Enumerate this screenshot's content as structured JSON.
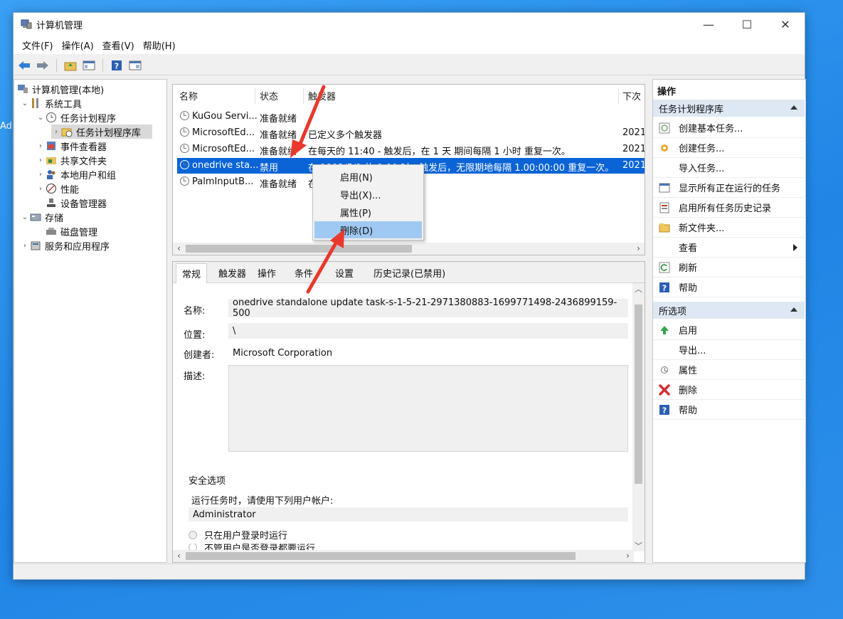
{
  "desktop": {
    "side_text": "Adı"
  },
  "window": {
    "title": "计算机管理",
    "controls": {
      "minimize": "—",
      "maximize": "☐",
      "close": "✕"
    }
  },
  "menu": [
    "文件(F)",
    "操作(A)",
    "查看(V)",
    "帮助(H)"
  ],
  "tree": {
    "items": [
      {
        "label": "计算机管理(本地)",
        "icon": "computer-management-icon"
      },
      {
        "label": "系统工具",
        "icon": "tools-icon"
      },
      {
        "label": "任务计划程序",
        "icon": "clock-icon"
      },
      {
        "label": "任务计划程序库",
        "icon": "folder-clock-icon"
      },
      {
        "label": "事件查看器",
        "icon": "event-viewer-icon"
      },
      {
        "label": "共享文件夹",
        "icon": "shared-folder-icon"
      },
      {
        "label": "本地用户和组",
        "icon": "users-icon"
      },
      {
        "label": "性能",
        "icon": "performance-icon"
      },
      {
        "label": "设备管理器",
        "icon": "device-manager-icon"
      },
      {
        "label": "存储",
        "icon": "storage-icon"
      },
      {
        "label": "磁盘管理",
        "icon": "disk-icon"
      },
      {
        "label": "服务和应用程序",
        "icon": "services-icon"
      }
    ]
  },
  "tasks": {
    "columns": [
      "名称",
      "状态",
      "触发器",
      "下次"
    ],
    "rows": [
      {
        "name": "KuGou Servi...",
        "status": "准备就绪",
        "trigger": "",
        "next": ""
      },
      {
        "name": "MicrosoftEd...",
        "status": "准备就绪",
        "trigger": "已定义多个触发器",
        "next": "2021"
      },
      {
        "name": "MicrosoftEd...",
        "status": "准备就绪",
        "trigger": "在每天的 11:40 - 触发后，在 1 天 期间每隔 1 小时 重复一次。",
        "next": "2021"
      },
      {
        "name": "onedrive sta...",
        "status": "禁用",
        "trigger": "在 1992/5/1 的 0:00 时 - 触发后，无限期地每隔 1.00:00:00 重复一次。",
        "next": "2021"
      },
      {
        "name": "PalmInputB...",
        "status": "准备就绪",
        "trigger": "在",
        "next": ""
      }
    ]
  },
  "context_menu": {
    "items": [
      "启用(N)",
      "导出(X)...",
      "属性(P)",
      "删除(D)"
    ]
  },
  "details": {
    "tabs": [
      "常规",
      "触发器",
      "操作",
      "条件",
      "设置",
      "历史记录(已禁用)"
    ],
    "name_label": "名称:",
    "name_value": "onedrive standalone update task-s-1-5-21-2971380883-1699771498-2436899159-500",
    "location_label": "位置:",
    "location_value": "\\",
    "author_label": "创建者:",
    "author_value": "Microsoft Corporation",
    "desc_label": "描述:",
    "security_title": "安全选项",
    "run_as_text": "运行任务时，请使用下列用户帐户:",
    "user_value": "Administrator",
    "radio_logged_on": "只在用户登录时运行",
    "radio_whether": "不管用户是否登录都要运行"
  },
  "actions": {
    "header": "操作",
    "section1": "任务计划程序库",
    "section1_items": [
      {
        "label": "创建基本任务...",
        "icon": "create-basic-task-icon"
      },
      {
        "label": "创建任务...",
        "icon": "create-task-icon"
      },
      {
        "label": "导入任务...",
        "icon": ""
      },
      {
        "label": "显示所有正在运行的任务",
        "icon": "running-tasks-icon"
      },
      {
        "label": "启用所有任务历史记录",
        "icon": "history-icon"
      },
      {
        "label": "新文件夹...",
        "icon": "new-folder-icon"
      },
      {
        "label": "查看",
        "icon": ""
      },
      {
        "label": "刷新",
        "icon": "refresh-icon"
      },
      {
        "label": "帮助",
        "icon": "help-icon"
      }
    ],
    "section2": "所选项",
    "section2_items": [
      {
        "label": "启用",
        "icon": "enable-icon"
      },
      {
        "label": "导出...",
        "icon": ""
      },
      {
        "label": "属性",
        "icon": "properties-icon"
      },
      {
        "label": "删除",
        "icon": "delete-icon"
      },
      {
        "label": "帮助",
        "icon": "help-icon"
      }
    ]
  },
  "colors": {
    "selection": "#0a64d6",
    "context_highlight": "#9fc9f2",
    "annotation_arrow": "#e8392c",
    "panel_header": "#dde8f4"
  }
}
